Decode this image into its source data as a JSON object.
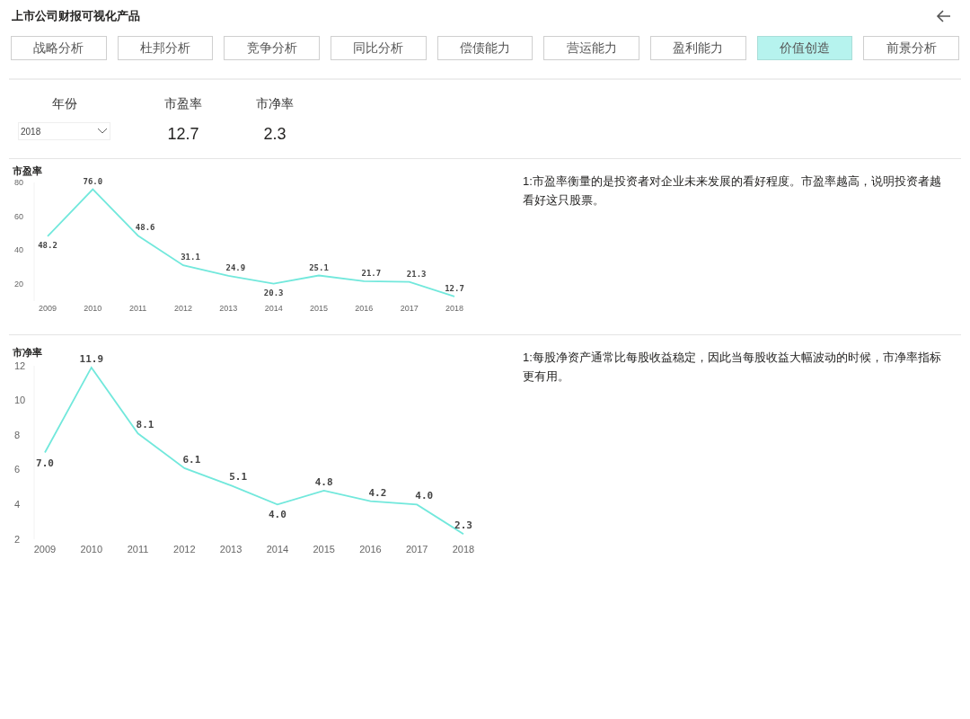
{
  "title": "上市公司财报可视化产品",
  "tabs": [
    {
      "label": "战略分析",
      "selected": false
    },
    {
      "label": "杜邦分析",
      "selected": false
    },
    {
      "label": "竞争分析",
      "selected": false
    },
    {
      "label": "同比分析",
      "selected": false
    },
    {
      "label": "偿债能力",
      "selected": false
    },
    {
      "label": "营运能力",
      "selected": false
    },
    {
      "label": "盈利能力",
      "selected": false
    },
    {
      "label": "价值创造",
      "selected": true
    },
    {
      "label": "前景分析",
      "selected": false
    }
  ],
  "filter": {
    "label": "年份",
    "value": "2018"
  },
  "kpis": [
    {
      "label": "市盈率",
      "value": "12.7"
    },
    {
      "label": "市净率",
      "value": "2.3"
    }
  ],
  "sections": [
    {
      "chart_data": {
        "type": "line",
        "title": "市盈率",
        "categories": [
          "2009",
          "2010",
          "2011",
          "2012",
          "2013",
          "2014",
          "2015",
          "2016",
          "2017",
          "2018"
        ],
        "series": [
          {
            "color": "#72e8dc",
            "values": [
              48.2,
              76.0,
              48.6,
              31.1,
              24.9,
              20.3,
              25.1,
              21.7,
              21.3,
              12.7
            ]
          }
        ],
        "ylim": [
          10,
          80
        ],
        "yticks": [
          20,
          40,
          60,
          80
        ],
        "value_labels": [
          "48.2",
          "76.0",
          "48.6",
          "31.1",
          "24.9",
          "20.3",
          "25.1",
          "21.7",
          "21.3",
          "12.7"
        ]
      },
      "note": "1:市盈率衡量的是投资者对企业未来发展的看好程度。市盈率越高，说明投资者越看好这只股票。"
    },
    {
      "chart_data": {
        "type": "line",
        "title": "市净率",
        "categories": [
          "2009",
          "2010",
          "2011",
          "2012",
          "2013",
          "2014",
          "2015",
          "2016",
          "2017",
          "2018"
        ],
        "series": [
          {
            "color": "#72e8dc",
            "values": [
              7.0,
              11.9,
              8.1,
              6.1,
              5.1,
              4.0,
              4.8,
              4.2,
              4.0,
              2.3
            ]
          }
        ],
        "ylim": [
          2,
          12
        ],
        "yticks": [
          2,
          4,
          6,
          8,
          10,
          12
        ],
        "value_labels": [
          "7.0",
          "11.9",
          "8.1",
          "6.1",
          "5.1",
          "4.0",
          "4.8",
          "4.2",
          "4.0",
          "2.3"
        ]
      },
      "note": "1:每股净资产通常比每股收益稳定，因此当每股收益大幅波动的时候，市净率指标更有用。"
    }
  ]
}
